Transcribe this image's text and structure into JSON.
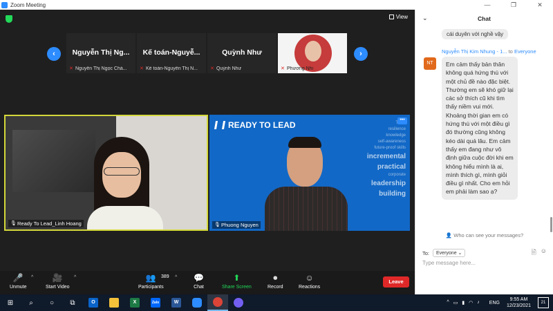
{
  "window": {
    "title": "Zoom Meeting"
  },
  "meeting": {
    "view_label": "View",
    "gallery": [
      {
        "name": "Nguyễn Thị Ng...",
        "label": "Nguyễn Thị Ngọc Chá..."
      },
      {
        "name": "Kế toán-Nguyễ...",
        "label": "Kế toán-Nguyễn Thị N..."
      },
      {
        "name": "Quỳnh Như",
        "label": "Quỳnh Như"
      },
      {
        "name": "",
        "label": "Phương Nhi"
      }
    ],
    "videos": [
      {
        "label": "Ready To Lead_Linh Hoang"
      },
      {
        "label": "Phuong Nguyen",
        "overlay_title": "READY TO LEAD",
        "overlay_words": [
          "TEFL",
          "resilience",
          "knowledge",
          "self-awareness",
          "future-proof skills",
          "incremental",
          "practical",
          "corporate",
          "leadership",
          "building"
        ]
      }
    ]
  },
  "toolbar": {
    "unmute": "Unmute",
    "start_video": "Start Video",
    "participants": "Participants",
    "participants_count": "389",
    "chat": "Chat",
    "share_screen": "Share Screen",
    "record": "Record",
    "reactions": "Reactions",
    "leave": "Leave"
  },
  "chat": {
    "title": "Chat",
    "previous_message": "cái duyên với nghề vậy",
    "sender": "Nguyễn Thị Kim Nhung - 1...",
    "to_word": "to",
    "recipient": "Everyone",
    "avatar_initials": "NT",
    "message": "Em cảm thấy bản thân không quá hứng thú với một chủ đề nào đặc biệt. Thường em sẽ khó giữ lại các sở thích cũ khi tìm thấy niềm vui mới. Khoảng thời gian em có hứng thú với một điều gì đó thường cũng không kéo dài quá lâu. Em cảm thấy em đang như vô định giữa cuộc đời khi em không hiểu mình là ai, mình thích gì, mình giỏi điều gì nhất. Cho em hỏi em phải làm sao ạ?",
    "who_can_see": "Who can see your messages?",
    "to_label": "To:",
    "to_select": "Everyone",
    "input_placeholder": "Type message here..."
  },
  "taskbar": {
    "apps": [
      {
        "icon": "outlook-icon",
        "text": "O",
        "color": "#0a64c8"
      },
      {
        "icon": "file-explorer-icon",
        "text": "",
        "color": "#f3c13a"
      },
      {
        "icon": "excel-icon",
        "text": "X",
        "color": "#1d7a45"
      },
      {
        "icon": "zalo-icon",
        "text": "Zalo",
        "color": "#0068ff"
      },
      {
        "icon": "word-icon",
        "text": "W",
        "color": "#2b5797"
      },
      {
        "icon": "zoom-icon",
        "text": "",
        "color": "#2d8cff"
      },
      {
        "icon": "chrome-icon",
        "text": "",
        "color": "#db4437"
      },
      {
        "icon": "viber-icon",
        "text": "",
        "color": "#7360f2"
      }
    ],
    "language": "ENG",
    "time": "9:55 AM",
    "date": "12/23/2021",
    "notifications": "21"
  }
}
